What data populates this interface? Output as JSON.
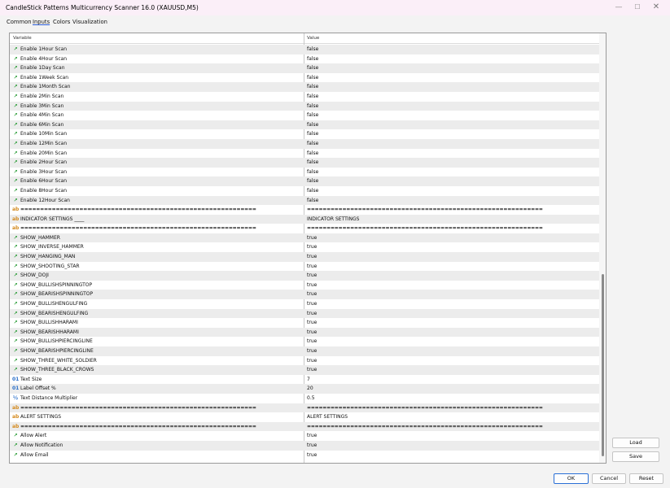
{
  "window": {
    "title": "CandleStick Patterns Multicurrency Scanner 16.0 (XAUUSD,M5)",
    "controls": {
      "minimize": "—",
      "maximize": "☐",
      "close": "✕"
    }
  },
  "tabs": [
    {
      "label": "Common"
    },
    {
      "label": "Inputs"
    },
    {
      "label": "Colors"
    },
    {
      "label": "Visualization"
    }
  ],
  "grid": {
    "headers": {
      "variable": "Variable",
      "value": "Value"
    },
    "rows": [
      {
        "icon": "bool",
        "name": "Enable 1Hour Scan",
        "value": "false"
      },
      {
        "icon": "bool",
        "name": "Enable 4Hour Scan",
        "value": "false"
      },
      {
        "icon": "bool",
        "name": "Enable 1Day Scan",
        "value": "false"
      },
      {
        "icon": "bool",
        "name": "Enable 1Week Scan",
        "value": "false"
      },
      {
        "icon": "bool",
        "name": "Enable 1Month Scan",
        "value": "false"
      },
      {
        "icon": "bool",
        "name": "Enable 2Min Scan",
        "value": "false"
      },
      {
        "icon": "bool",
        "name": "Enable 3Min Scan",
        "value": "false"
      },
      {
        "icon": "bool",
        "name": "Enable 4Min Scan",
        "value": "false"
      },
      {
        "icon": "bool",
        "name": "Enable 6Min Scan",
        "value": "false"
      },
      {
        "icon": "bool",
        "name": "Enable 10Min Scan",
        "value": "false"
      },
      {
        "icon": "bool",
        "name": "Enable 12Min Scan",
        "value": "false"
      },
      {
        "icon": "bool",
        "name": "Enable 20Min Scan",
        "value": "false"
      },
      {
        "icon": "bool",
        "name": "Enable 2Hour Scan",
        "value": "false"
      },
      {
        "icon": "bool",
        "name": "Enable 3Hour Scan",
        "value": "false"
      },
      {
        "icon": "bool",
        "name": "Enable 6Hour Scan",
        "value": "false"
      },
      {
        "icon": "bool",
        "name": "Enable 8Hour Scan",
        "value": "false"
      },
      {
        "icon": "bool",
        "name": "Enable 12Hour Scan",
        "value": "false"
      },
      {
        "icon": "str",
        "name": "============================================================",
        "value": "============================================================",
        "sep": true
      },
      {
        "icon": "str",
        "name": "INDICATOR SETTINGS ____",
        "value": "INDICATOR SETTINGS"
      },
      {
        "icon": "str",
        "name": "============================================================",
        "value": "============================================================",
        "sep": true
      },
      {
        "icon": "bool",
        "name": "SHOW_HAMMER",
        "value": "true"
      },
      {
        "icon": "bool",
        "name": "SHOW_INVERSE_HAMMER",
        "value": "true"
      },
      {
        "icon": "bool",
        "name": "SHOW_HANGING_MAN",
        "value": "true"
      },
      {
        "icon": "bool",
        "name": "SHOW_SHOOTING_STAR",
        "value": "true"
      },
      {
        "icon": "bool",
        "name": "SHOW_DOJI",
        "value": "true"
      },
      {
        "icon": "bool",
        "name": "SHOW_BULLISHSPINNINGTOP",
        "value": "true"
      },
      {
        "icon": "bool",
        "name": "SHOW_BEARISHSPINNINGTOP",
        "value": "true"
      },
      {
        "icon": "bool",
        "name": "SHOW_BULLISHENGULFING",
        "value": "true"
      },
      {
        "icon": "bool",
        "name": "SHOW_BEARISHENGULFING",
        "value": "true"
      },
      {
        "icon": "bool",
        "name": "SHOW_BULLISHHARAMI",
        "value": "true"
      },
      {
        "icon": "bool",
        "name": "SHOW_BEARISHHARAMI",
        "value": "true"
      },
      {
        "icon": "bool",
        "name": "SHOW_BULLISHPIERCINGLINE",
        "value": "true"
      },
      {
        "icon": "bool",
        "name": "SHOW_BEARISHPIERCINGLINE",
        "value": "true"
      },
      {
        "icon": "bool",
        "name": "SHOW_THREE_WHITE_SOLDIER",
        "value": "true"
      },
      {
        "icon": "bool",
        "name": "SHOW_THREE_BLACK_CROWS",
        "value": "true"
      },
      {
        "icon": "int",
        "name": "Text Size",
        "value": "7"
      },
      {
        "icon": "int",
        "name": "Label Offset %",
        "value": "20"
      },
      {
        "icon": "double",
        "name": "Text Distance Multiplier",
        "value": "0.5"
      },
      {
        "icon": "str",
        "name": "============================================================",
        "value": "============================================================",
        "sep": true
      },
      {
        "icon": "str",
        "name": "ALERT SETTINGS",
        "value": "ALERT SETTINGS"
      },
      {
        "icon": "str",
        "name": "============================================================",
        "value": "============================================================",
        "sep": true
      },
      {
        "icon": "bool",
        "name": "Allow Alert",
        "value": "true"
      },
      {
        "icon": "bool",
        "name": "Allow Notification",
        "value": "true"
      },
      {
        "icon": "bool",
        "name": "Allow Email",
        "value": "true"
      }
    ],
    "icon_glyphs": {
      "bool": "↗",
      "str": "ab",
      "int": "01",
      "double": "½"
    }
  },
  "buttons": {
    "load": "Load",
    "save": "Save",
    "ok": "OK",
    "cancel": "Cancel",
    "reset": "Reset"
  }
}
